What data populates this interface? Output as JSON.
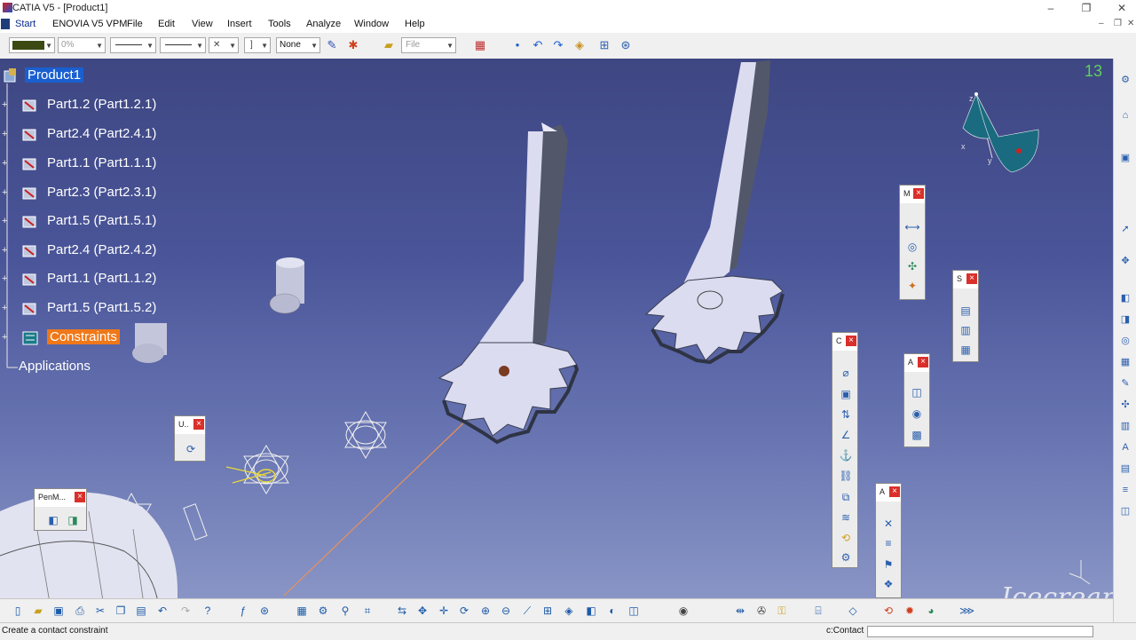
{
  "window": {
    "title": "CATIA V5 - [Product1]",
    "minimize": "–",
    "maximize": "❐",
    "close": "✕"
  },
  "menu": {
    "items": [
      "Start",
      "ENOVIA V5 VPM",
      "File",
      "Edit",
      "View",
      "Insert",
      "Tools",
      "Analyze",
      "Window",
      "Help"
    ]
  },
  "toolbar": {
    "percent": "0%",
    "layer": "None",
    "file_field": "File",
    "cross_symbol": "✕"
  },
  "tree": {
    "root": "Product1",
    "parts": [
      "Part1.2 (Part1.2.1)",
      "Part2.4 (Part2.4.1)",
      "Part1.1 (Part1.1.1)",
      "Part2.3 (Part2.3.1)",
      "Part1.5 (Part1.5.1)",
      "Part2.4 (Part2.4.2)",
      "Part1.1 (Part1.1.2)",
      "Part1.5 (Part1.5.2)"
    ],
    "constraints": "Constraints",
    "applications": "Applications"
  },
  "floating_toolbars": {
    "update": {
      "title": "U.."
    },
    "pen_mode": {
      "title": "PenM..."
    },
    "constraints_tb": {
      "title": "C"
    },
    "measure": {
      "title": "M"
    },
    "space_analysis": {
      "title": "S"
    },
    "assembly_features": {
      "title": "A"
    },
    "annotations": {
      "title": "A"
    }
  },
  "viewport": {
    "corner_number": "13",
    "axis_labels": [
      "x",
      "y",
      "z"
    ]
  },
  "status": {
    "message": "Create a contact constraint",
    "command_prefix": "c:Contact"
  },
  "watermark": "Icecream",
  "colors": {
    "viewport_top": "#3e4782",
    "viewport_bottom": "#8e9ac8",
    "part_face": "#d9d9ee",
    "highlight_orange": "#f07818",
    "selection_blue": "#1a5fd0",
    "close_red": "#d9302b"
  }
}
